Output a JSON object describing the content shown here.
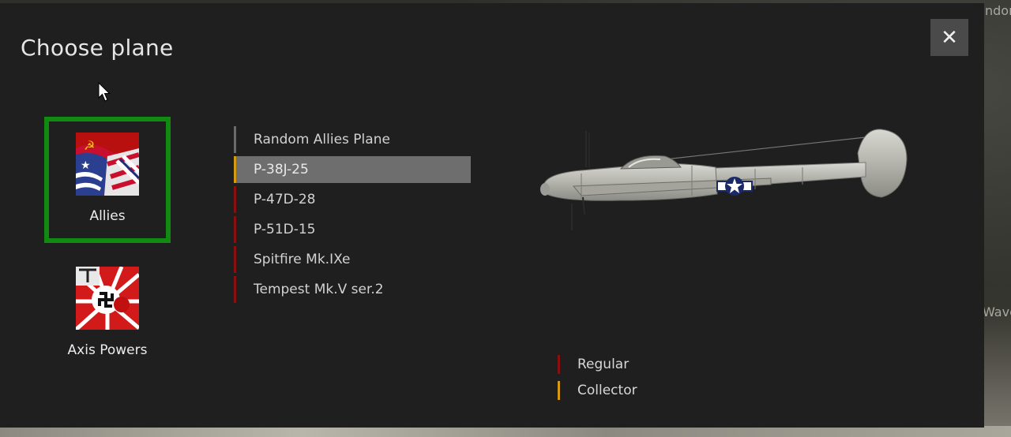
{
  "dialog": {
    "title": "Choose plane",
    "close_label": "✕"
  },
  "background": {
    "corner_text": "ndom",
    "side_text": "Wave"
  },
  "factions": [
    {
      "label": "Allies",
      "selected": true
    },
    {
      "label": "Axis Powers",
      "selected": false
    }
  ],
  "planes": [
    {
      "label": "Random Allies Plane",
      "tier": "random",
      "selected": false
    },
    {
      "label": "P-38J-25",
      "tier": "collector",
      "selected": true
    },
    {
      "label": "P-47D-28",
      "tier": "regular",
      "selected": false
    },
    {
      "label": "P-51D-15",
      "tier": "regular",
      "selected": false
    },
    {
      "label": "Spitfire Mk.IXe",
      "tier": "regular",
      "selected": false
    },
    {
      "label": "Tempest Mk.V ser.2",
      "tier": "regular",
      "selected": false
    }
  ],
  "legend": {
    "regular": "Regular",
    "collector": "Collector"
  },
  "colors": {
    "regular": "#8a0f0f",
    "collector": "#d49a14",
    "random": "#6a6a6a",
    "selected_border": "#108a10"
  }
}
